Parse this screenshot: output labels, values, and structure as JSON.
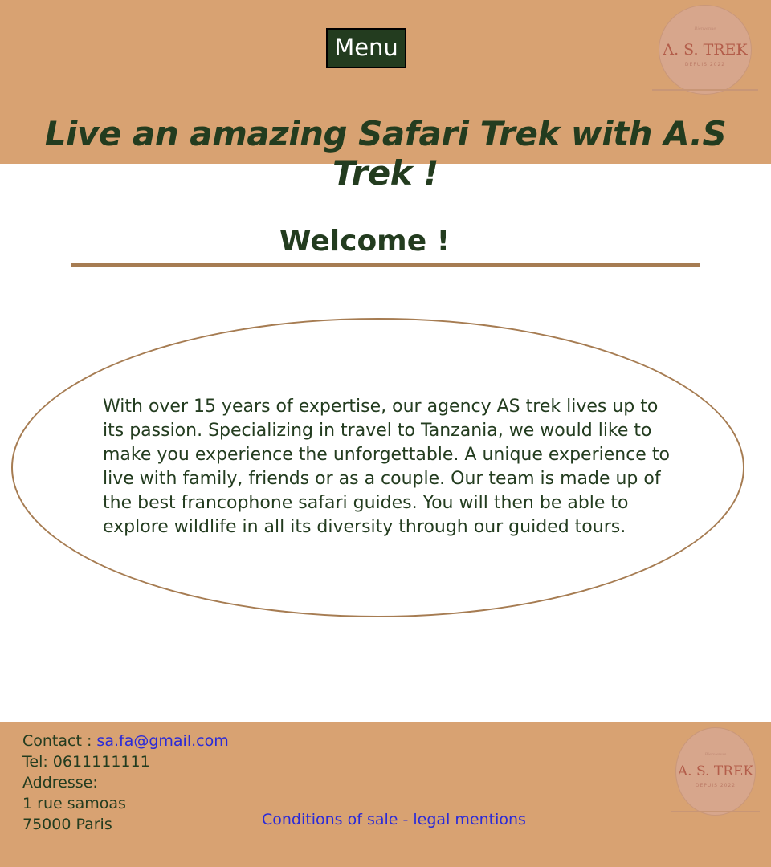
{
  "header": {
    "menu_label": "Menu",
    "title": "Live an amazing Safari Trek with A.S Trek !",
    "logo": {
      "name": "A. S. TREK",
      "tagline": "DEPUIS 2022",
      "script": "Bienvenue"
    }
  },
  "main": {
    "welcome": "Welcome !",
    "intro": "With over 15 years of expertise, our agency AS trek lives up to its passion. Specializing in travel to Tanzania, we would like to make you experience the unforgettable. A unique experience to live with family, friends or as a couple. Our team is made up of the best francophone safari guides. You will then be able to explore wildlife in all its diversity through our guided tours."
  },
  "footer": {
    "contact_label": "Contact :",
    "email": "sa.fa@gmail.com",
    "tel": "Tel: 0611111111",
    "address_label": "Addresse:",
    "address_line1": "1 rue samoas",
    "address_line2": "75000 Paris",
    "legal_link": "Conditions of sale - legal mentions",
    "logo": {
      "name": "A. S. TREK",
      "tagline": "DEPUIS 2022",
      "script": "Bienvenue"
    }
  },
  "colors": {
    "header_bg": "#d8a272",
    "accent_green": "#233c1f",
    "accent_brown": "#a67c52",
    "link_blue": "#2a2ad8"
  }
}
